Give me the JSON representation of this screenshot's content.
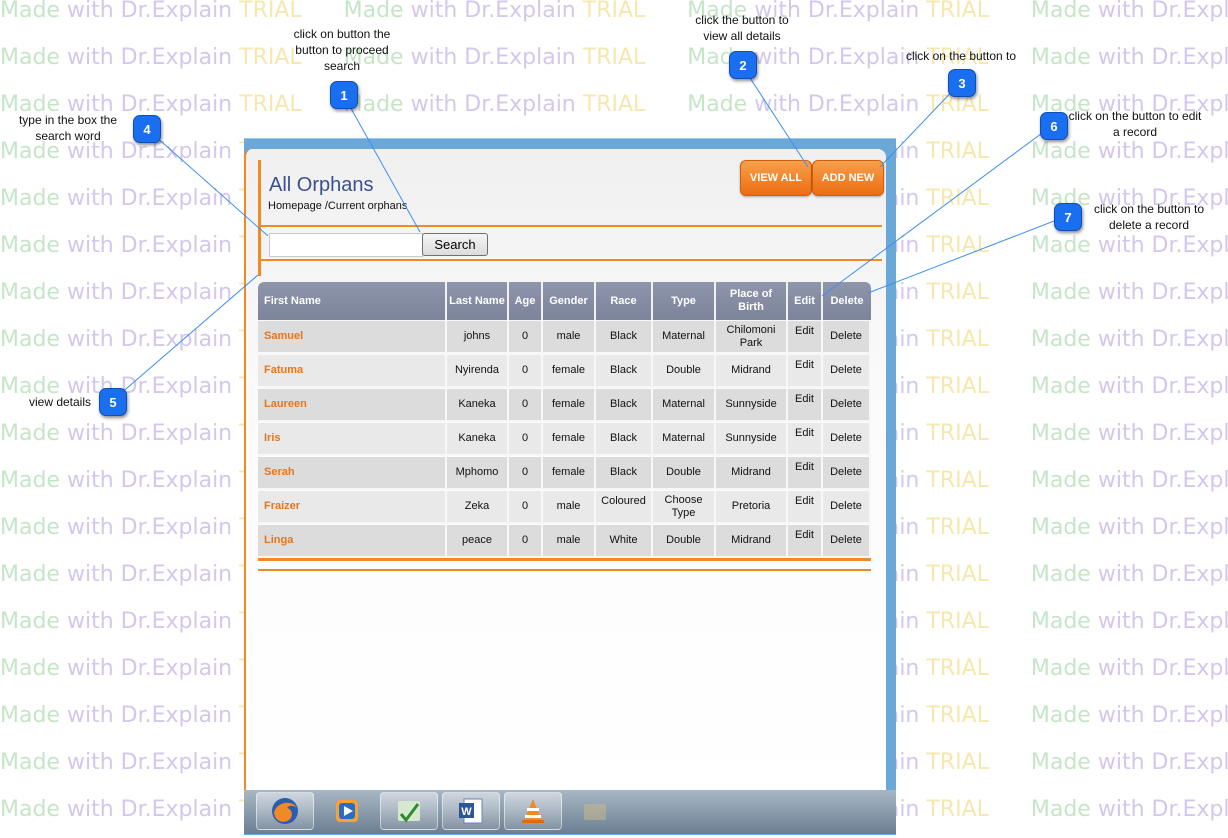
{
  "watermark": {
    "part1": "Made ",
    "part2": "with Dr.Explain ",
    "part3": "TRIAL"
  },
  "callouts": [
    {
      "num": "1",
      "text": "click on button the button to proceed search"
    },
    {
      "num": "2",
      "text": "click the button to view all details"
    },
    {
      "num": "3",
      "text": "click on the button to"
    },
    {
      "num": "4",
      "text": "type in the box the search word"
    },
    {
      "num": "5",
      "text": "view details"
    },
    {
      "num": "6",
      "text": "click on the button to edit a record"
    },
    {
      "num": "7",
      "text": "click on the button to delete a record"
    }
  ],
  "header": {
    "title": "All Orphans",
    "breadcrumb": "Homepage /Current orphans"
  },
  "toolbar": {
    "view_all": "VIEW ALL",
    "add_new": "ADD NEW"
  },
  "search": {
    "value": "",
    "placeholder": "",
    "button": "Search"
  },
  "table": {
    "columns": [
      "First Name",
      "Last Name",
      "Age",
      "Gender",
      "Race",
      "Type",
      "Place of Birth",
      "Edit",
      "Delete"
    ],
    "rows": [
      {
        "first": "Samuel",
        "last": "johns",
        "age": "0",
        "gender": "male",
        "race": "Black",
        "type": "Maternal",
        "place": "Chilomoni Park",
        "edit": "Edit",
        "delete": "Delete"
      },
      {
        "first": "Fatuma",
        "last": "Nyirenda",
        "age": "0",
        "gender": "female",
        "race": "Black",
        "type": "Double",
        "place": "Midrand",
        "edit": "Edit",
        "delete": "Delete"
      },
      {
        "first": "Laureen",
        "last": "Kaneka",
        "age": "0",
        "gender": "female",
        "race": "Black",
        "type": "Maternal",
        "place": "Sunnyside",
        "edit": "Edit",
        "delete": "Delete"
      },
      {
        "first": "Iris",
        "last": "Kaneka",
        "age": "0",
        "gender": "female",
        "race": "Black",
        "type": "Maternal",
        "place": "Sunnyside",
        "edit": "Edit",
        "delete": "Delete"
      },
      {
        "first": "Serah",
        "last": "Mphomo",
        "age": "0",
        "gender": "female",
        "race": "Black",
        "type": "Double",
        "place": "Midrand",
        "edit": "Edit",
        "delete": "Delete"
      },
      {
        "first": "Fraizer",
        "last": "Zeka",
        "age": "0",
        "gender": "male",
        "race": "Coloured",
        "type": "Choose Type",
        "place": "Pretoria",
        "edit": "Edit",
        "delete": "Delete"
      },
      {
        "first": "Linga",
        "last": "peace",
        "age": "0",
        "gender": "male",
        "race": "White",
        "type": "Double",
        "place": "Midrand",
        "edit": "Edit",
        "delete": "Delete"
      }
    ]
  },
  "taskbar": {
    "items": [
      "firefox-icon",
      "media-player-icon",
      "app-icon",
      "word-icon",
      "vlc-icon",
      "explorer-icon"
    ]
  },
  "colors": {
    "accent": "#f08a24",
    "badge": "#1a6ff0",
    "header": "#7c839a",
    "title": "#3b4f8c"
  }
}
